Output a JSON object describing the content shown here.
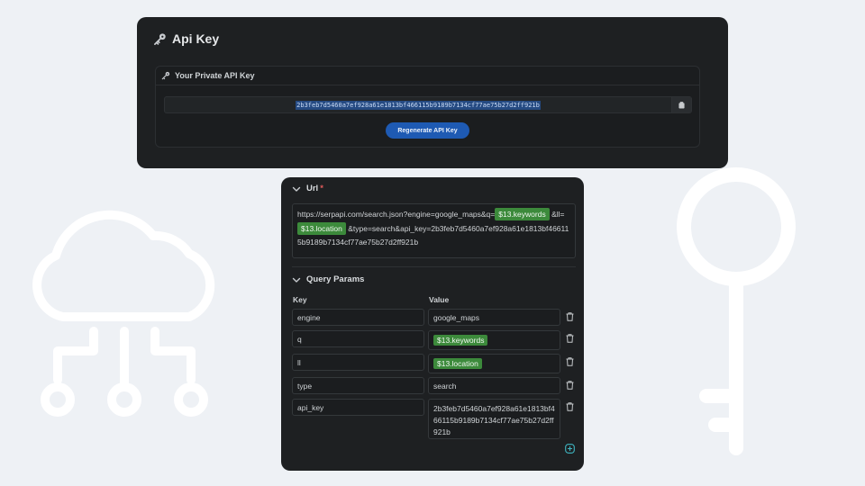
{
  "api_key_panel": {
    "title": "Api Key",
    "card_heading": "Your Private API Key",
    "key_value": "2b3feb7d5460a7ef928a61e1813bf466115b9189b7134cf77ae75b27d2ff921b",
    "regenerate_label": "Regenerate API Key"
  },
  "url_section": {
    "title": "Url",
    "required_mark": "*",
    "segments": [
      {
        "text": "https://serpapi.com/search.json?engine=google_maps&q=",
        "pill": false
      },
      {
        "text": "$13.keywords",
        "pill": true
      },
      {
        "text": " &ll=",
        "pill": false
      },
      {
        "text": "$13.location",
        "pill": true
      },
      {
        "text": " &type=search&api_key=2b3feb7d5460a7ef928a61e1813bf466115b9189b7134cf77ae75b27d2ff921b",
        "pill": false
      }
    ]
  },
  "query_params": {
    "title": "Query Params",
    "key_header": "Key",
    "value_header": "Value",
    "rows": [
      {
        "key": "engine",
        "value": "google_maps",
        "pill": false
      },
      {
        "key": "q",
        "value": "$13.keywords",
        "pill": true
      },
      {
        "key": "ll",
        "value": "$13.location",
        "pill": true
      },
      {
        "key": "type",
        "value": "search",
        "pill": false
      },
      {
        "key": "api_key",
        "value": "2b3feb7d5460a7ef928a61e1813bf466115b9189b7134cf77ae75b27d2ff921b",
        "pill": false
      }
    ]
  },
  "colors": {
    "panel_bg": "#1e2022",
    "accent_blue": "#1e5ab3",
    "variable_pill": "#3c8a3b",
    "add_icon": "#3fb6c2"
  },
  "icons": [
    "key-icon",
    "copy-icon",
    "chevron-down-icon",
    "trash-icon",
    "plus-circle-icon",
    "cloud-network-icon",
    "large-key-icon"
  ]
}
